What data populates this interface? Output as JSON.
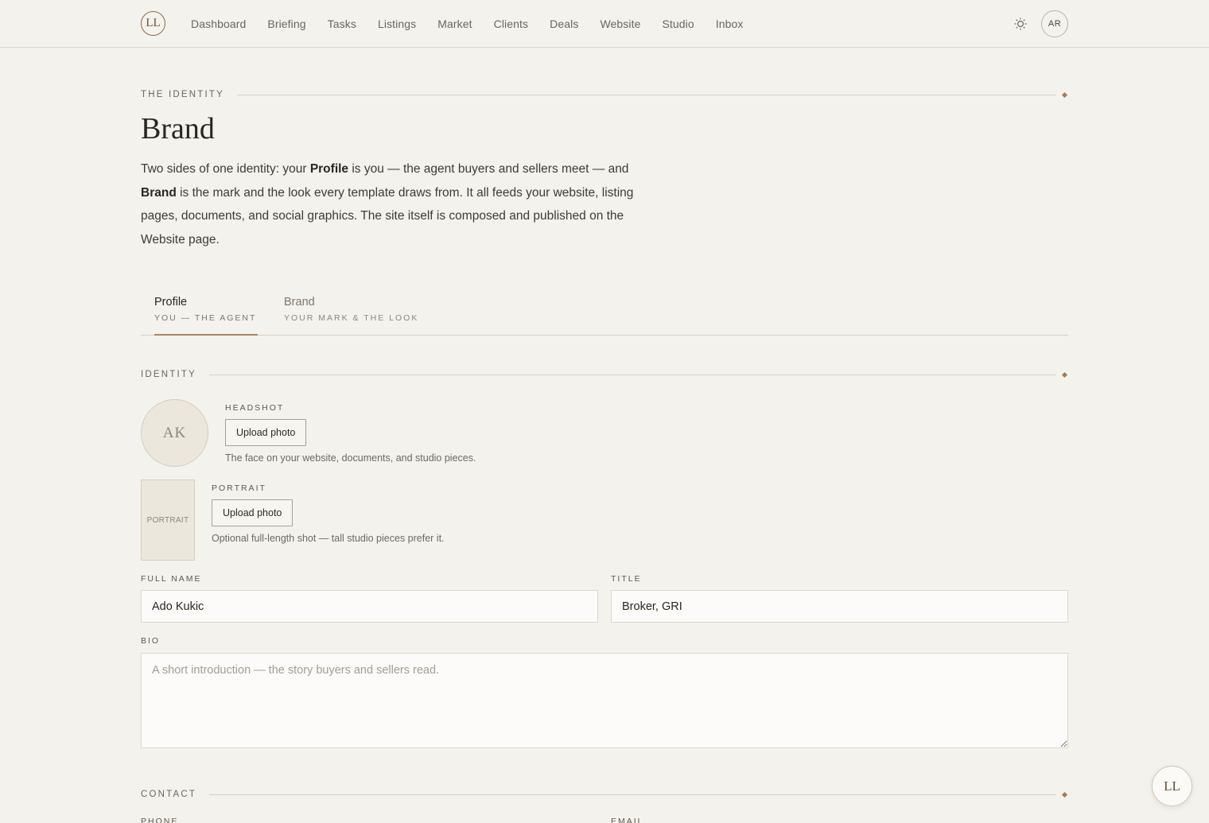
{
  "nav": {
    "logo": "LL",
    "items": [
      "Dashboard",
      "Briefing",
      "Tasks",
      "Listings",
      "Market",
      "Clients",
      "Deals",
      "Website",
      "Studio",
      "Inbox"
    ],
    "theme_icon": "sun-icon",
    "user_initials": "AR"
  },
  "header": {
    "eyebrow": "THE IDENTITY",
    "title": "Brand",
    "intro_1": "Two sides of one identity: your ",
    "intro_profile": "Profile",
    "intro_2": " is you — the agent buyers and sellers meet — and ",
    "intro_brand": "Brand",
    "intro_3": " is the mark and the look every template draws from. It all feeds your website, listing pages, documents, and social graphics. The site itself is composed and published on the Website page."
  },
  "tabs": [
    {
      "label": "Profile",
      "sub": "YOU — THE AGENT",
      "active": true
    },
    {
      "label": "Brand",
      "sub": "YOUR MARK & THE LOOK",
      "active": false
    }
  ],
  "identity": {
    "section_label": "IDENTITY",
    "headshot_initials": "AK",
    "headshot_label": "HEADSHOT",
    "headshot_button": "Upload photo",
    "headshot_help": "The face on your website, documents, and studio pieces.",
    "portrait_placeholder": "PORTRAIT",
    "portrait_label": "PORTRAIT",
    "portrait_button": "Upload photo",
    "portrait_help": "Optional full-length shot — tall studio pieces prefer it.",
    "full_name_label": "FULL NAME",
    "full_name_value": "Ado Kukic",
    "title_label": "TITLE",
    "title_value": "Broker, GRI",
    "bio_label": "BIO",
    "bio_placeholder": "A short introduction — the story buyers and sellers read."
  },
  "contact": {
    "section_label": "CONTACT",
    "phone_label": "PHONE",
    "email_label": "EMAIL"
  },
  "fab": {
    "label": "LL"
  },
  "colors": {
    "accent": "#a57b52",
    "background": "#f4f2ed",
    "text": "#2a2620"
  }
}
